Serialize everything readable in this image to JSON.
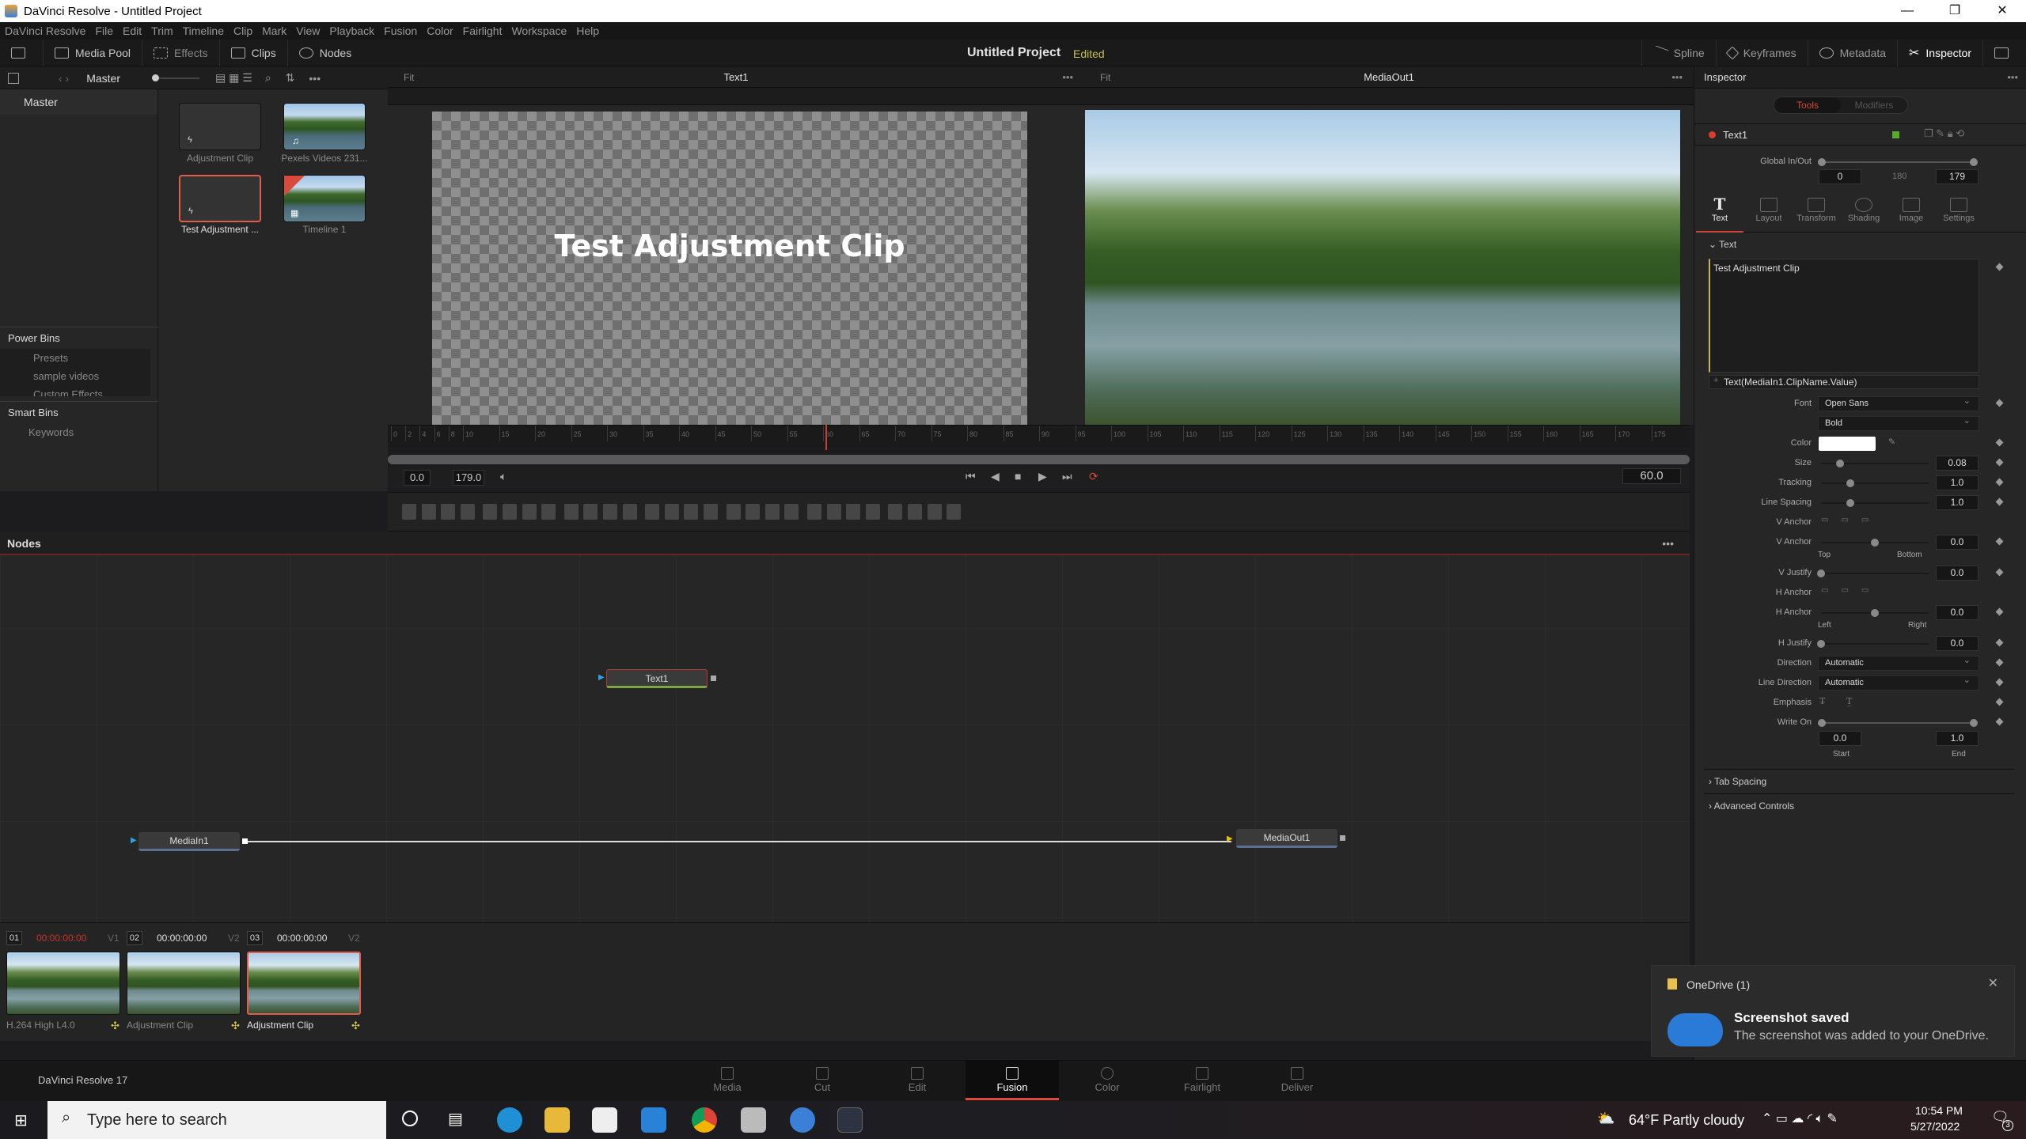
{
  "window": {
    "title": "DaVinci Resolve - Untitled Project",
    "controls": [
      "minimize",
      "restore",
      "close"
    ]
  },
  "menu": [
    "DaVinci Resolve",
    "File",
    "Edit",
    "Trim",
    "Timeline",
    "Clip",
    "Mark",
    "View",
    "Playback",
    "Fusion",
    "Color",
    "Fairlight",
    "Workspace",
    "Help"
  ],
  "toolbar": {
    "left": [
      {
        "label": "Media Pool",
        "icon": "media-pool-icon"
      },
      {
        "label": "Effects",
        "icon": "effects-icon"
      },
      {
        "label": "Clips",
        "icon": "clips-icon"
      },
      {
        "label": "Nodes",
        "icon": "nodes-icon"
      }
    ],
    "project_name": "Untitled Project",
    "project_status": "Edited",
    "right": [
      {
        "label": "Spline",
        "icon": "spline-icon"
      },
      {
        "label": "Keyframes",
        "icon": "keyframes-icon"
      },
      {
        "label": "Metadata",
        "icon": "metadata-icon"
      },
      {
        "label": "Inspector",
        "icon": "inspector-icon"
      }
    ]
  },
  "media_pool": {
    "bin_header": "Master",
    "bins_title": "Master",
    "power_bins": {
      "title": "Power Bins",
      "items": [
        "Presets",
        "sample videos",
        "Custom Effects"
      ]
    },
    "smart_bins": {
      "title": "Smart Bins",
      "items": [
        "Keywords"
      ]
    },
    "clips": [
      {
        "name": "Adjustment Clip",
        "type": "adjustment",
        "selected": false
      },
      {
        "name": "Pexels Videos 231...",
        "type": "video",
        "selected": false
      },
      {
        "name": "Test Adjustment ...",
        "type": "adjustment",
        "selected": true
      },
      {
        "name": "Timeline 1",
        "type": "timeline",
        "selected": false
      }
    ]
  },
  "viewer_left": {
    "title": "Text1",
    "fit": "Fit",
    "overlay_text": "Test Adjustment Clip"
  },
  "viewer_right": {
    "title": "MediaOut1",
    "fit": "Fit"
  },
  "ruler": {
    "ticks": [
      "0",
      "2",
      "4",
      "6",
      "8",
      "10",
      "15",
      "20",
      "25",
      "30",
      "35",
      "40",
      "45",
      "50",
      "55",
      "60",
      "65",
      "70",
      "75",
      "80",
      "85",
      "90",
      "95",
      "100",
      "105",
      "110",
      "115",
      "120",
      "125",
      "130",
      "135",
      "140",
      "145",
      "150",
      "155",
      "160",
      "165",
      "170",
      "175"
    ],
    "playhead": 60
  },
  "transport": {
    "start": "0.0",
    "end": "179.0",
    "current": "60.0"
  },
  "nodes_panel": {
    "title": "Nodes",
    "nodes": [
      {
        "name": "Text1",
        "selected": true
      },
      {
        "name": "MediaIn1",
        "selected": false
      },
      {
        "name": "MediaOut1",
        "selected": false
      }
    ]
  },
  "clip_timeline": {
    "clips": [
      {
        "num": "01",
        "timecode": "00:00:00:00",
        "track": "V1",
        "label": "H.264 High L4.0",
        "active": true
      },
      {
        "num": "02",
        "timecode": "00:00:00:00",
        "track": "V2",
        "label": "Adjustment Clip",
        "active": false
      },
      {
        "num": "03",
        "timecode": "00:00:00:00",
        "track": "V2",
        "label": "Adjustment Clip",
        "active": false,
        "selected": true
      }
    ]
  },
  "pages": {
    "app_name": "DaVinci Resolve 17",
    "items": [
      "Media",
      "Cut",
      "Edit",
      "Fusion",
      "Color",
      "Fairlight",
      "Deliver"
    ],
    "active": "Fusion"
  },
  "inspector": {
    "title": "Inspector",
    "segments": [
      "Tools",
      "Modifiers"
    ],
    "node_name": "Text1",
    "global_in_out": {
      "label": "Global In/Out",
      "in": "0",
      "mid": "180",
      "out": "179"
    },
    "tabs": [
      "Text",
      "Layout",
      "Transform",
      "Shading",
      "Image",
      "Settings"
    ],
    "active_tab": "Text",
    "section": "Text",
    "styled_text": "Test Adjustment Clip",
    "expression": "Text(MediaIn1.ClipName.Value)",
    "font": {
      "label": "Font",
      "family": "Open Sans",
      "style": "Bold"
    },
    "color_label": "Color",
    "sliders": [
      {
        "label": "Size",
        "value": "0.08",
        "fraction": 0.18
      },
      {
        "label": "Tracking",
        "value": "1.0",
        "fraction": 0.27
      },
      {
        "label": "Line Spacing",
        "value": "1.0",
        "fraction": 0.27
      }
    ],
    "v_anchor_buttons_label": "V Anchor",
    "v_anchor": {
      "label": "V Anchor",
      "value": "0.0",
      "fraction": 0.5,
      "min_label": "Top",
      "max_label": "Bottom"
    },
    "v_justify": {
      "label": "V Justify",
      "value": "0.0",
      "fraction": 0.0
    },
    "h_anchor_buttons_label": "H Anchor",
    "h_anchor": {
      "label": "H Anchor",
      "value": "0.0",
      "fraction": 0.5,
      "min_label": "Left",
      "max_label": "Right"
    },
    "h_justify": {
      "label": "H Justify",
      "value": "0.0",
      "fraction": 0.0
    },
    "direction": {
      "label": "Direction",
      "value": "Automatic"
    },
    "line_direction": {
      "label": "Line Direction",
      "value": "Automatic"
    },
    "emphasis_label": "Emphasis",
    "write_on": {
      "label": "Write On",
      "start": "0.0",
      "end": "1.0",
      "start_label": "Start",
      "end_label": "End"
    },
    "collapsed_sections": [
      "Tab Spacing",
      "Advanced Controls"
    ]
  },
  "notification": {
    "app": "OneDrive (1)",
    "title": "Screenshot saved",
    "body": "The screenshot was added to your OneDrive."
  },
  "taskbar": {
    "search_placeholder": "Type here to search",
    "weather": "64°F  Partly cloudy",
    "time": "10:54 PM",
    "date": "5/27/2022",
    "notification_count": "3"
  }
}
